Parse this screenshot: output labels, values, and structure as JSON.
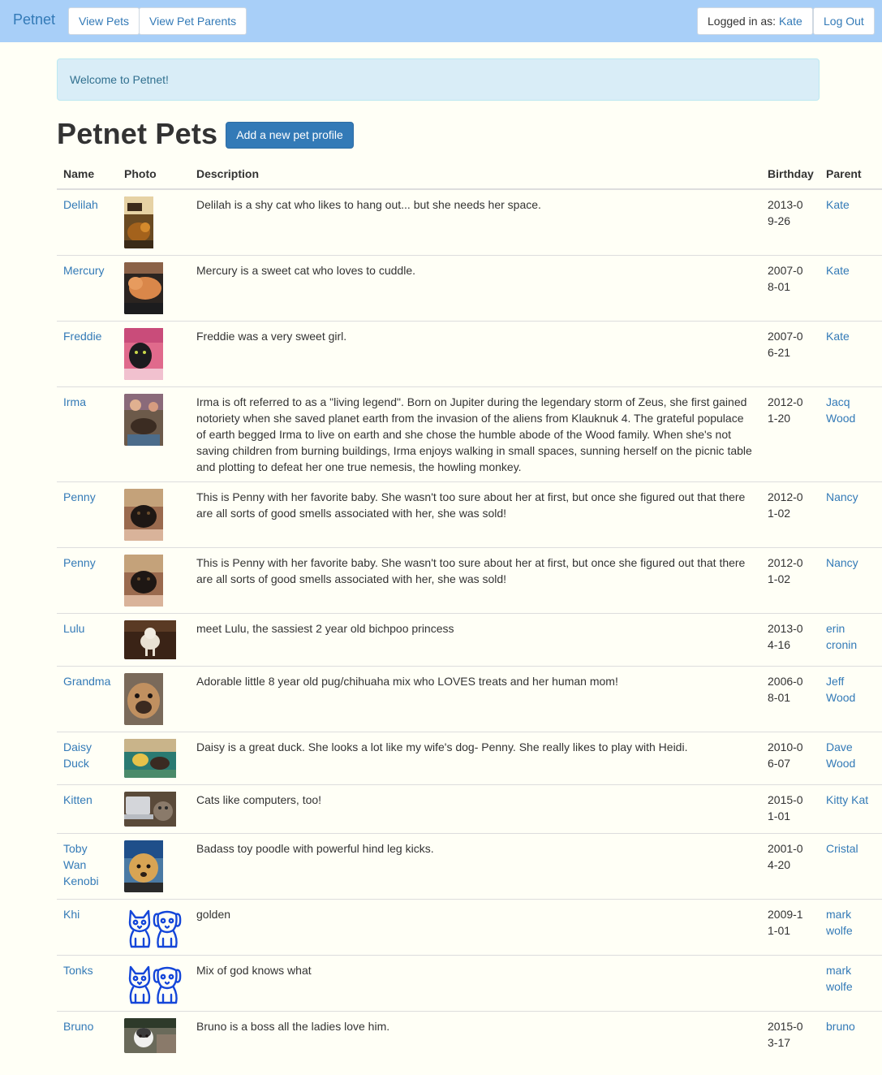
{
  "navbar": {
    "brand": "Petnet",
    "links": [
      "View Pets",
      "View Pet Parents"
    ],
    "logged_in_label": "Logged in as: ",
    "logged_in_user": "Kate",
    "logout": "Log Out"
  },
  "alert": {
    "text": "Welcome to Petnet!"
  },
  "page": {
    "title": "Petnet Pets",
    "add_button": "Add a new pet profile"
  },
  "table": {
    "headers": [
      "Name",
      "Photo",
      "Description",
      "Birthday",
      "Parent"
    ],
    "rows": [
      {
        "name": "Delilah",
        "description": "Delilah is a shy cat who likes to hang out... but she needs her space.",
        "birthday": "2013-09-26",
        "parent": "Kate",
        "photo": "photo-cat-orange-couch"
      },
      {
        "name": "Mercury",
        "description": "Mercury is a sweet cat who loves to cuddle.",
        "birthday": "2007-08-01",
        "parent": "Kate",
        "photo": "photo-cat-orange-sleeping"
      },
      {
        "name": "Freddie",
        "description": "Freddie was a very sweet girl.",
        "birthday": "2007-06-21",
        "parent": "Kate",
        "photo": "photo-cat-black-pink"
      },
      {
        "name": "Irma",
        "description": "Irma is oft referred to as a \"living legend\". Born on Jupiter during the legendary storm of Zeus, she first gained notoriety when she saved planet earth from the invasion of the aliens from Klauknuk 4. The grateful populace of earth begged Irma to live on earth and she chose the humble abode of the Wood family. When she's not saving children from burning buildings, Irma enjoys walking in small spaces, sunning herself on the picnic table and plotting to defeat her one true nemesis, the howling monkey.",
        "birthday": "2012-01-20",
        "parent": "Jacq Wood",
        "photo": "photo-dog-kids"
      },
      {
        "name": "Penny",
        "description": "This is Penny with her favorite baby. She wasn't too sure about her at first, but once she figured out that there are all sorts of good smells associated with her, she was sold!",
        "birthday": "2012-01-02",
        "parent": "Nancy",
        "photo": "photo-dog-baby"
      },
      {
        "name": "Penny",
        "description": "This is Penny with her favorite baby. She wasn't too sure about her at first, but once she figured out that there are all sorts of good smells associated with her, she was sold!",
        "birthday": "2012-01-02",
        "parent": "Nancy",
        "photo": "photo-dog-baby"
      },
      {
        "name": "Lulu",
        "description": "meet Lulu, the sassiest 2 year old bichpoo princess",
        "birthday": "2013-04-16",
        "parent": "erin cronin",
        "photo": "photo-dog-white-floor"
      },
      {
        "name": "Grandma",
        "description": "Adorable little 8 year old pug/chihuaha mix who LOVES treats and her human mom!",
        "birthday": "2006-08-01",
        "parent": "Jeff Wood",
        "photo": "photo-dog-pug"
      },
      {
        "name": "Daisy Duck",
        "description": "Daisy is a great duck. She looks a lot like my wife's dog- Penny. She really likes to play with Heidi.",
        "birthday": "2010-06-07",
        "parent": "Dave Wood",
        "photo": "photo-duck-toy"
      },
      {
        "name": "Kitten",
        "description": "Cats like computers, too!",
        "birthday": "2015-01-01",
        "parent": "Kitty Kat",
        "photo": "photo-cat-laptop"
      },
      {
        "name": "Toby Wan Kenobi",
        "description": "Badass toy poodle with powerful hind leg kicks.",
        "birthday": "2001-04-20",
        "parent": "Cristal",
        "photo": "photo-poodle"
      },
      {
        "name": "Khi",
        "description": "golden",
        "birthday": "2009-11-01",
        "parent": "mark wolfe",
        "photo": "placeholder-cat-dog-icon"
      },
      {
        "name": "Tonks",
        "description": "Mix of god knows what",
        "birthday": "",
        "parent": "mark wolfe",
        "photo": "placeholder-cat-dog-icon"
      },
      {
        "name": "Bruno",
        "description": "Bruno is a boss all the ladies love him.",
        "birthday": "2015-03-17",
        "parent": "bruno",
        "photo": "photo-dog-husky"
      }
    ]
  }
}
